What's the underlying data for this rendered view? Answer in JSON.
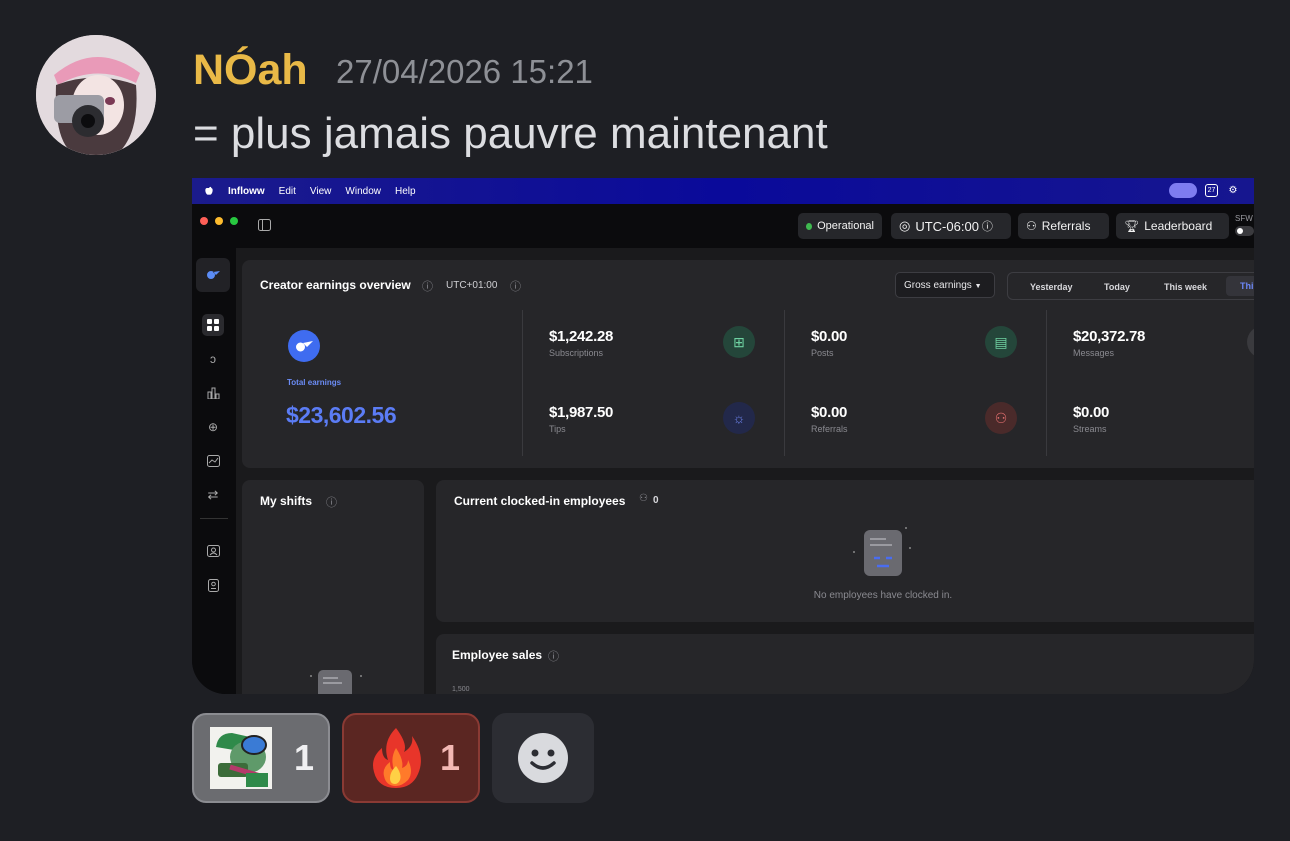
{
  "message": {
    "author": "NÓah",
    "timestamp": "27/04/2026 15:21",
    "text": "= plus jamais pauvre maintenant",
    "author_color": "#e9b947"
  },
  "attachment": {
    "menubar": {
      "apple_icon": "apple-logo-icon",
      "app": "Infloww",
      "items": [
        "Edit",
        "View",
        "Window",
        "Help"
      ],
      "calendar_day": "27"
    },
    "toolbar": {
      "status": "Operational",
      "timezone": "UTC-06:00",
      "referrals": "Referrals",
      "leaderboard": "Leaderboard",
      "sfw": "SFW"
    },
    "earnings": {
      "title": "Creator earnings overview",
      "tz": "UTC+01:00",
      "dropdown": "Gross earnings",
      "ranges": [
        "Yesterday",
        "Today",
        "This week",
        "Thi"
      ],
      "total_label": "Total earnings",
      "total_value": "$23,602.56",
      "items": [
        {
          "value": "$1,242.28",
          "label": "Subscriptions"
        },
        {
          "value": "$0.00",
          "label": "Posts"
        },
        {
          "value": "$20,372.78",
          "label": "Messages"
        },
        {
          "value": "$1,987.50",
          "label": "Tips"
        },
        {
          "value": "$0.00",
          "label": "Referrals"
        },
        {
          "value": "$0.00",
          "label": "Streams"
        }
      ]
    },
    "shifts": {
      "title": "My shifts"
    },
    "clocked": {
      "title": "Current clocked-in employees",
      "count": "0",
      "empty": "No employees have clocked in."
    },
    "sales": {
      "title": "Employee sales",
      "axis_top": "1,500"
    },
    "colors": {
      "accent": "#4f6bf0",
      "status_green": "#3fb950"
    }
  },
  "reactions": [
    {
      "emoji": "money-frog-emoji",
      "count": "1"
    },
    {
      "emoji": "fire-emoji",
      "count": "1"
    }
  ],
  "add_reaction_icon": "smiley-icon"
}
